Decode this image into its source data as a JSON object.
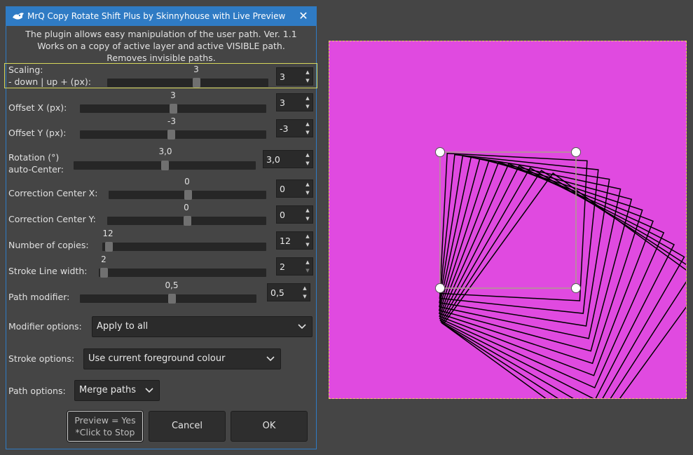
{
  "window": {
    "title": "MrQ Copy Rotate Shift Plus by Skinnyhouse with Live Preview",
    "close_icon": "close-icon",
    "app_icon": "gimp-wilber-icon"
  },
  "description": [
    "The plugin allows easy manipulation of the user path. Ver. 1.1",
    "Works on a copy of active layer and active VISIBLE path.",
    "Removes invisible paths."
  ],
  "controls": {
    "scaling": {
      "label1": "Scaling:",
      "label2": " - down | up + (px):",
      "value": "3",
      "spin": "3",
      "level": 0.55
    },
    "offset_x": {
      "label": "Offset X (px):",
      "value": "3",
      "spin": "3",
      "level": 0.5
    },
    "offset_y": {
      "label": "Offset Y (px):",
      "value": "-3",
      "spin": "-3",
      "level": 0.49
    },
    "rotation": {
      "label1": "Rotation (°)",
      "label2": "auto-Center:",
      "value": "3,0",
      "spin": "3,0",
      "level": 0.5
    },
    "corr_x": {
      "label": "Correction Center X:",
      "value": "0",
      "spin": "0",
      "level": 0.5
    },
    "corr_y": {
      "label": "Correction Center Y:",
      "value": "0",
      "spin": "0",
      "level": 0.5
    },
    "copies": {
      "label": "Number of copies:",
      "value": "12",
      "spin": "12",
      "level": 0.0
    },
    "stroke_width": {
      "label": "Stroke Line width:",
      "value": "2",
      "spin": "2",
      "level": 0.0
    },
    "path_modifier": {
      "label": "Path modifier:",
      "value": "0,5",
      "spin": "0,5",
      "level": 0.5
    }
  },
  "options": {
    "modifier": {
      "label": "Modifier options:",
      "value": "Apply to all"
    },
    "stroke": {
      "label": "Stroke options:",
      "value": "Use current foreground colour"
    },
    "path": {
      "label": "Path options:",
      "value": "Merge paths"
    }
  },
  "buttons": {
    "preview_line1": "Preview = Yes",
    "preview_line2": "*Click to Stop",
    "cancel": "Cancel",
    "ok": "OK"
  },
  "canvas": {
    "background": "#e04ae0",
    "path_color": "#000000",
    "selection_color": "#f0c8c8"
  }
}
